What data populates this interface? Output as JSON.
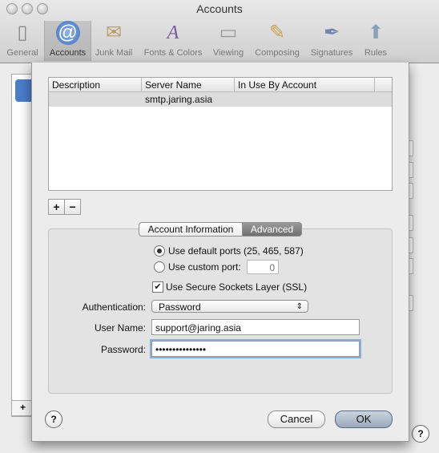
{
  "window": {
    "title": "Accounts"
  },
  "toolbar": [
    {
      "label": "General",
      "icon": "general-switch-icon",
      "active": false
    },
    {
      "label": "Accounts",
      "icon": "at-sign-icon",
      "active": true
    },
    {
      "label": "Junk Mail",
      "icon": "junk-mail-icon",
      "active": false
    },
    {
      "label": "Fonts & Colors",
      "icon": "fonts-colors-icon",
      "active": false
    },
    {
      "label": "Viewing",
      "icon": "viewing-icon",
      "active": false
    },
    {
      "label": "Composing",
      "icon": "composing-icon",
      "active": false
    },
    {
      "label": "Signatures",
      "icon": "signatures-icon",
      "active": false
    },
    {
      "label": "Rules",
      "icon": "rules-icon",
      "active": false
    }
  ],
  "server_table": {
    "columns": [
      "Description",
      "Server Name",
      "In Use By Account"
    ],
    "rows": [
      {
        "description": "",
        "server_name": "smtp.jaring.asia",
        "in_use_by": ""
      }
    ],
    "add_label": "+",
    "remove_label": "−"
  },
  "tabs": {
    "account_information": "Account Information",
    "advanced": "Advanced"
  },
  "advanced": {
    "default_ports_label": "Use default ports (25, 465, 587)",
    "custom_port_label": "Use custom port:",
    "custom_port_value": "0",
    "ssl_label": "Use Secure Sockets Layer (SSL)",
    "ssl_checked": true,
    "authentication_label": "Authentication:",
    "authentication_value": "Password",
    "user_name_label": "User Name:",
    "user_name_value": "support@jaring.asia",
    "password_label": "Password:",
    "password_value": "•••••••••••••••"
  },
  "buttons": {
    "cancel": "Cancel",
    "ok": "OK",
    "help": "?"
  },
  "background": {
    "add_label": "+",
    "help": "?"
  }
}
